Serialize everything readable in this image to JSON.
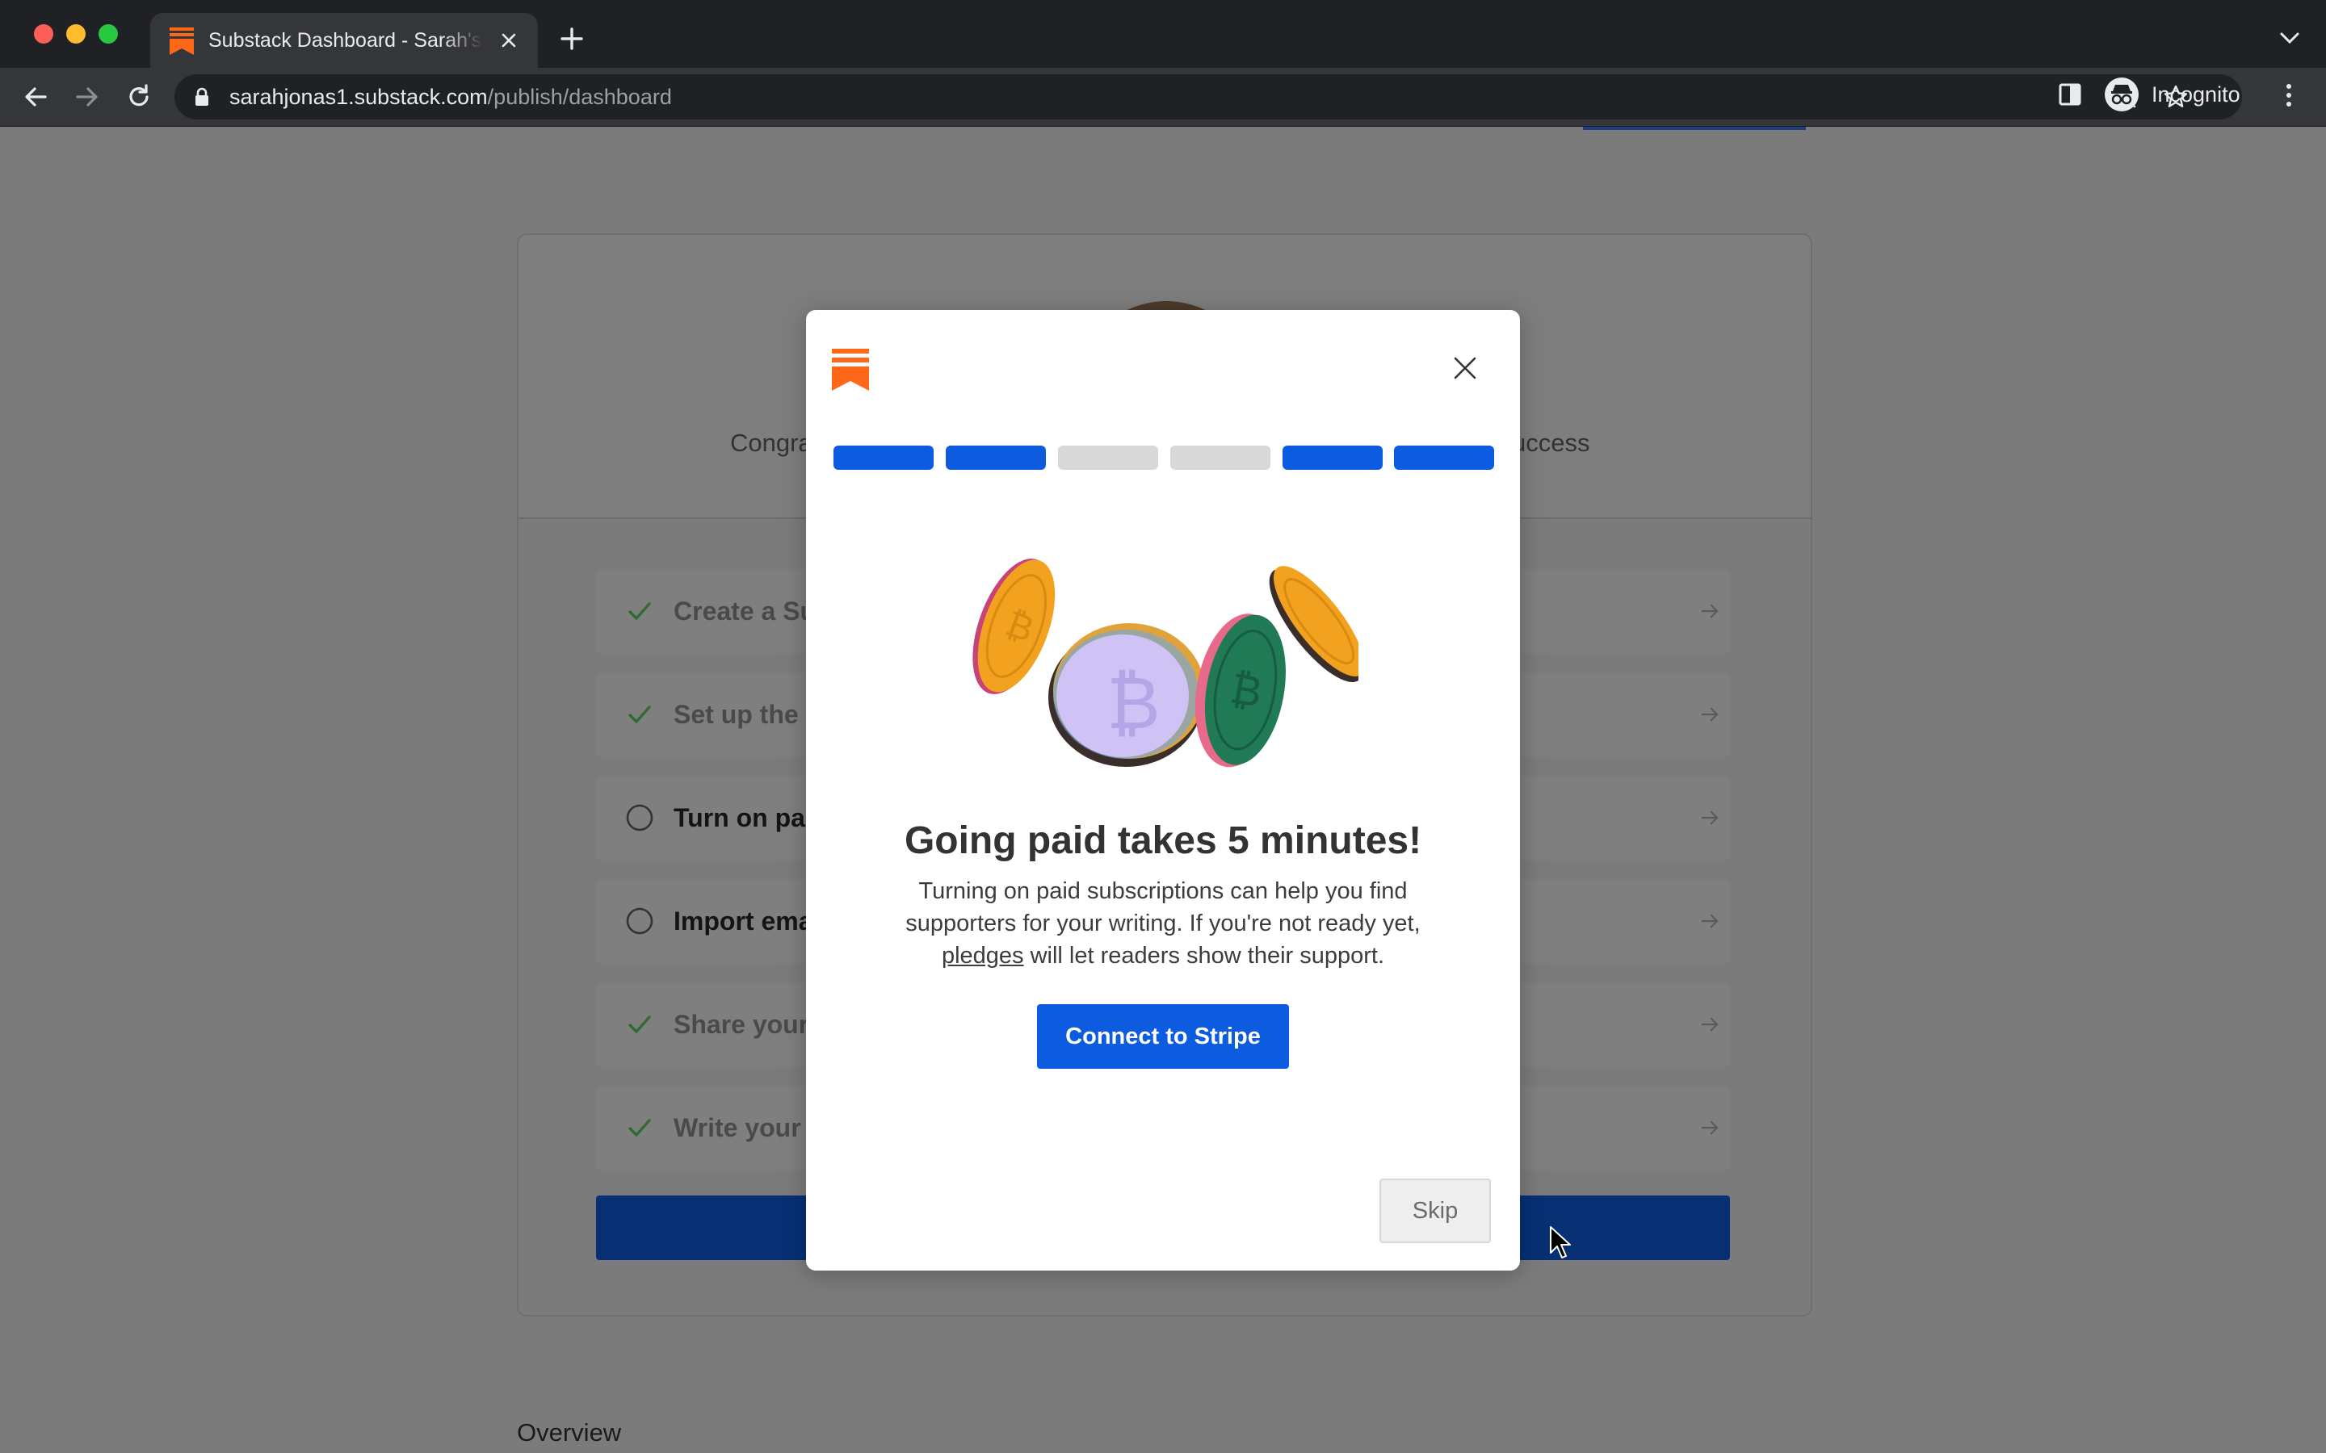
{
  "browser": {
    "tab_title": "Substack Dashboard - Sarah's",
    "url_host": "sarahjonas1.substack.com",
    "url_path": "/publish/dashboard",
    "profile_label": "Incognito"
  },
  "dashboard": {
    "subtitle_left": "Congra",
    "subtitle_right": "uccess",
    "tasks": [
      {
        "label": "Create a Su",
        "done": true
      },
      {
        "label": "Set up the l",
        "done": true
      },
      {
        "label": "Turn on pai",
        "done": false
      },
      {
        "label": "Import ema",
        "done": false
      },
      {
        "label": "Share your",
        "done": true
      },
      {
        "label": "Write your",
        "done": true
      }
    ],
    "section_heading": "Overview"
  },
  "modal": {
    "progress_steps": [
      "active",
      "active",
      "inactive",
      "inactive",
      "active",
      "active"
    ],
    "title": "Going paid takes 5 minutes!",
    "desc_part1": "Turning on paid subscriptions can help you find supporters for your writing. If you're not ready yet, ",
    "desc_link": "pledges",
    "desc_part2": " will let readers show their support.",
    "primary_button": "Connect to Stripe",
    "skip_button": "Skip"
  },
  "colors": {
    "brand": "#ff6719",
    "accent": "#0d5ce0",
    "step_inactive": "#d8d8d8"
  }
}
